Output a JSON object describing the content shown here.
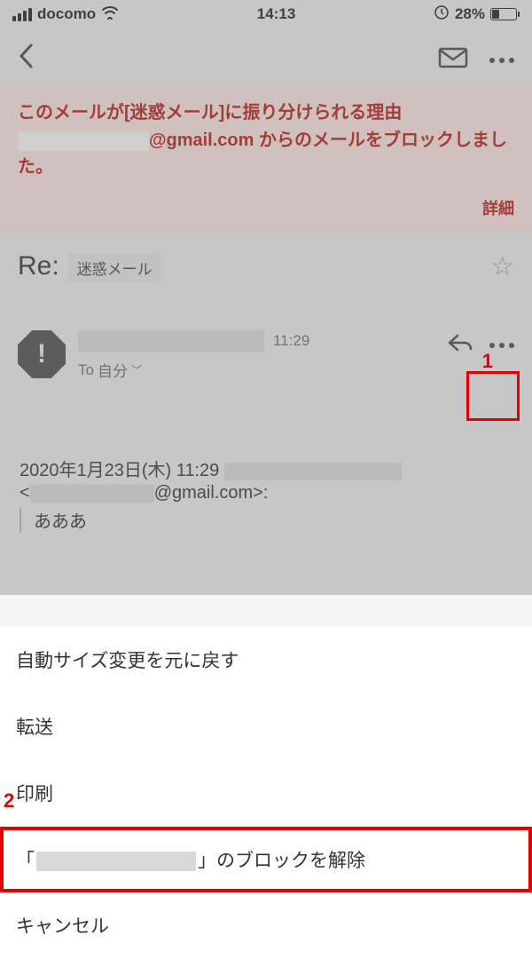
{
  "status": {
    "carrier": "docomo",
    "time": "14:13",
    "battery_pct": "28%"
  },
  "spam": {
    "title": "このメールが[迷惑メール]に振り分けられる理由",
    "body_suffix": "@gmail.com からのメールをブロックしました。",
    "detail": "詳細"
  },
  "subject": {
    "re": "Re:",
    "label": "迷惑メール"
  },
  "sender": {
    "time": "11:29",
    "to_prefix": "To",
    "to_value": "自分"
  },
  "body": {
    "date_line": "2020年1月23日(木) 11:29",
    "email_suffix": "@gmail.com>:",
    "email_prefix": "<",
    "quote": "あああ"
  },
  "sheet": {
    "autosize": "自動サイズ変更を元に戻す",
    "forward": "転送",
    "print": "印刷",
    "unblock_prefix": "「",
    "unblock_suffix": "」のブロックを解除",
    "cancel": "キャンセル"
  },
  "callouts": {
    "one": "1",
    "two": "2"
  }
}
